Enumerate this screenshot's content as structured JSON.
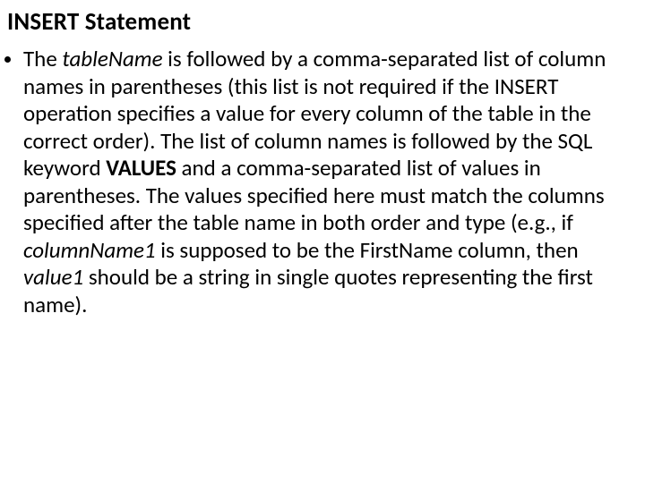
{
  "title": "INSERT Statement",
  "bullet": {
    "p1a": "The ",
    "tableName": "tableName",
    "p1b": " is followed by a comma-separated list of column names in parentheses (this list is not required if the INSERT operation specifies a value for every column of the table in the correct order). The list of column names is followed by the SQL keyword ",
    "values": "VALUES",
    "p1c": " and a comma-separated list of values in parentheses. The values specified here must match the columns specified after the table name in both order and type (e.g., if ",
    "columnName1": "columnName1",
    "p1d": " is supposed to be the FirstName column, then ",
    "value1": "value1",
    "p1e": " should be a string in single quotes representing the first name)."
  }
}
